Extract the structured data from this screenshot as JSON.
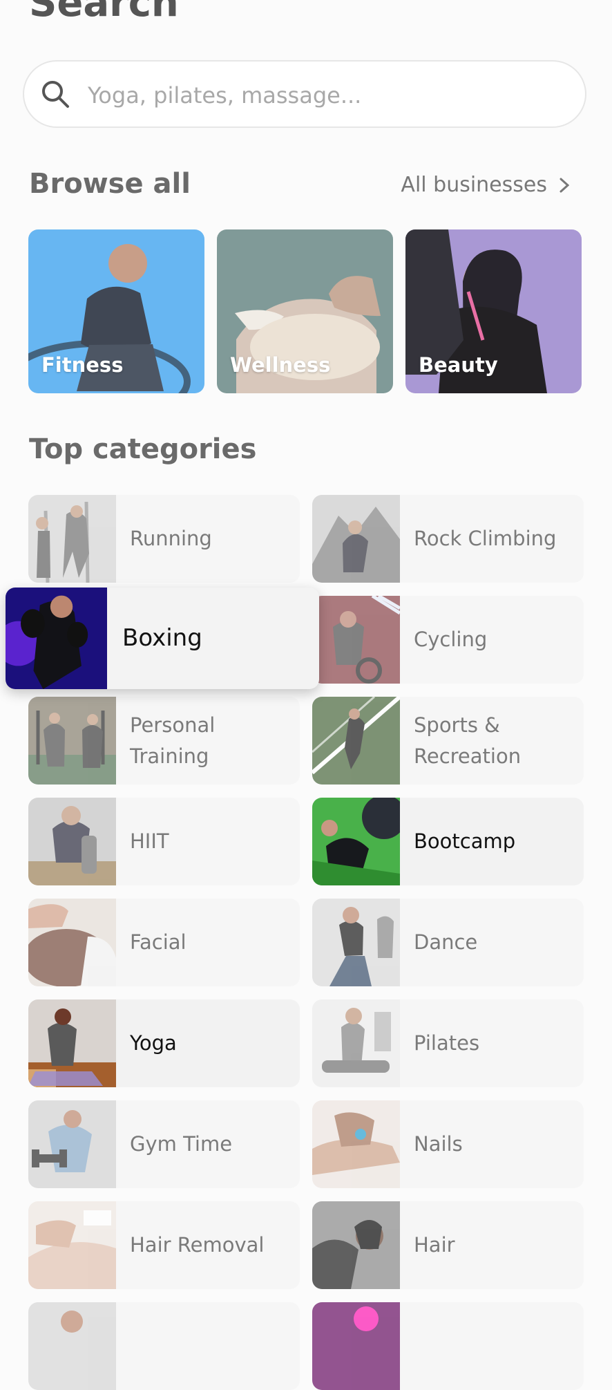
{
  "header": {
    "title": "Search"
  },
  "search": {
    "placeholder": "Yoga, pilates, massage..."
  },
  "browse": {
    "title": "Browse all",
    "all_link": "All businesses",
    "tiles": [
      {
        "label": "Fitness",
        "color": "#67b6f2"
      },
      {
        "label": "Wellness",
        "color": "#809a98"
      },
      {
        "label": "Beauty",
        "color": "#a998d4"
      }
    ]
  },
  "categories": {
    "title": "Top categories",
    "items": [
      {
        "label": "Running"
      },
      {
        "label": "Rock Climbing"
      },
      {
        "label": "Boxing"
      },
      {
        "label": "Cycling"
      },
      {
        "label": "Personal Training"
      },
      {
        "label": "Sports & Recreation"
      },
      {
        "label": "HIIT"
      },
      {
        "label": "Bootcamp"
      },
      {
        "label": "Facial"
      },
      {
        "label": "Dance"
      },
      {
        "label": "Yoga"
      },
      {
        "label": "Pilates"
      },
      {
        "label": "Gym Time"
      },
      {
        "label": "Nails"
      },
      {
        "label": "Hair Removal"
      },
      {
        "label": "Hair"
      },
      {
        "label": ""
      },
      {
        "label": ""
      }
    ]
  }
}
